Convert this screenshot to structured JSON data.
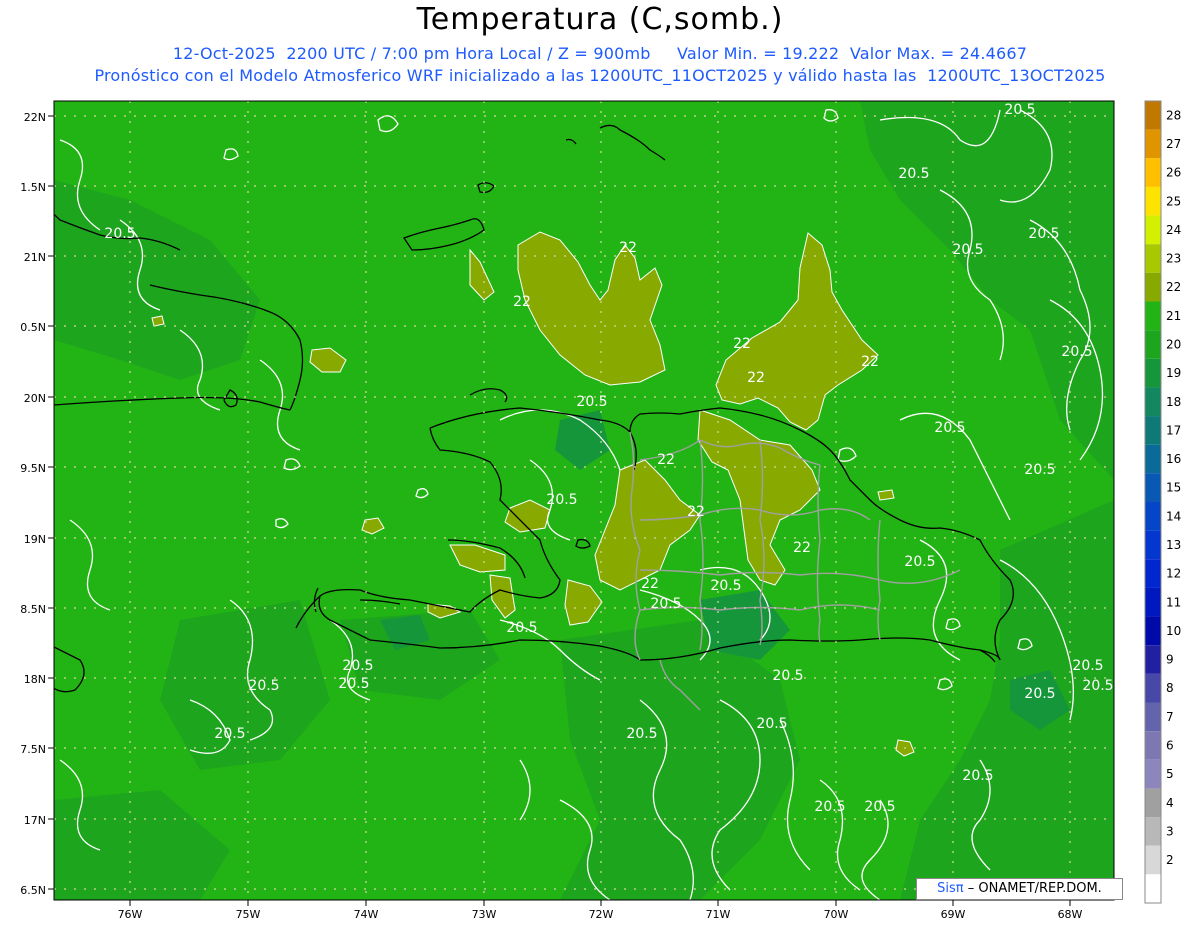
{
  "header": {
    "title": "Temperatura (C,somb.)",
    "line1": "12-Oct-2025  2200 UTC / 7:00 pm Hora Local / Z = 900mb     Valor Min. = 19.222  Valor Max. = 24.4667",
    "line2": "Pronóstico con el Modelo Atmosferico WRF inicializado a las 1200UTC_11OCT2025 y válido hasta las  1200UTC_13OCT2025"
  },
  "axes": {
    "lat_labels": [
      "22N",
      "1.5N",
      "21N",
      "0.5N",
      "20N",
      "9.5N",
      "19N",
      "8.5N",
      "18N",
      "7.5N",
      "17N",
      "6.5N"
    ],
    "lon_labels": [
      "76W",
      "75W",
      "74W",
      "73W",
      "72W",
      "71W",
      "70W",
      "69W",
      "68W"
    ]
  },
  "colorbar": {
    "labels": [
      "28",
      "27",
      "26",
      "25",
      "24",
      "23",
      "22",
      "21",
      "20",
      "19",
      "18",
      "17",
      "16",
      "15",
      "14",
      "13",
      "12",
      "11",
      "10",
      "9",
      "8",
      "7",
      "6",
      "5",
      "4",
      "3",
      "2"
    ],
    "colors": [
      "#c07800",
      "#e09400",
      "#ffc000",
      "#ffe300",
      "#d2f000",
      "#a8c800",
      "#88aa00",
      "#22b414",
      "#1ea51e",
      "#16963a",
      "#128760",
      "#0e7a78",
      "#0a6a98",
      "#0858b4",
      "#0546c8",
      "#0436d0",
      "#0026d0",
      "#0018c0",
      "#000aa8",
      "#2020a0",
      "#4848a8",
      "#6464ac",
      "#7e78b2",
      "#8c86bc",
      "#a0a0a0",
      "#b8b8b8",
      "#d8d8d8",
      "#ffffff"
    ]
  },
  "contour_labels": [
    {
      "text": "22"
    },
    {
      "text": "22"
    },
    {
      "text": "22"
    },
    {
      "text": "22"
    },
    {
      "text": "22"
    },
    {
      "text": "22"
    },
    {
      "text": "22"
    },
    {
      "text": "22"
    },
    {
      "text": "22"
    },
    {
      "text": "20.5"
    },
    {
      "text": "20.5"
    },
    {
      "text": "20.5"
    },
    {
      "text": "20.5"
    },
    {
      "text": "20.5"
    },
    {
      "text": "20.5"
    },
    {
      "text": "20.5"
    },
    {
      "text": "20.5"
    },
    {
      "text": "20.5"
    },
    {
      "text": "20.5"
    },
    {
      "text": "20.5"
    },
    {
      "text": "20.5"
    },
    {
      "text": "20.5"
    },
    {
      "text": "20.5"
    },
    {
      "text": "20.5"
    },
    {
      "text": "20.5"
    },
    {
      "text": "20.5"
    },
    {
      "text": "20.5"
    },
    {
      "text": "20.5"
    },
    {
      "text": "20.5"
    },
    {
      "text": "20.5"
    },
    {
      "text": "20.5"
    },
    {
      "text": "20.5"
    },
    {
      "text": "20.5"
    },
    {
      "text": "20.5"
    },
    {
      "text": "20.5"
    },
    {
      "text": "20.5"
    }
  ],
  "credit": {
    "brand": "Sisπ",
    "text": "– ONAMET/REP.DOM."
  }
}
